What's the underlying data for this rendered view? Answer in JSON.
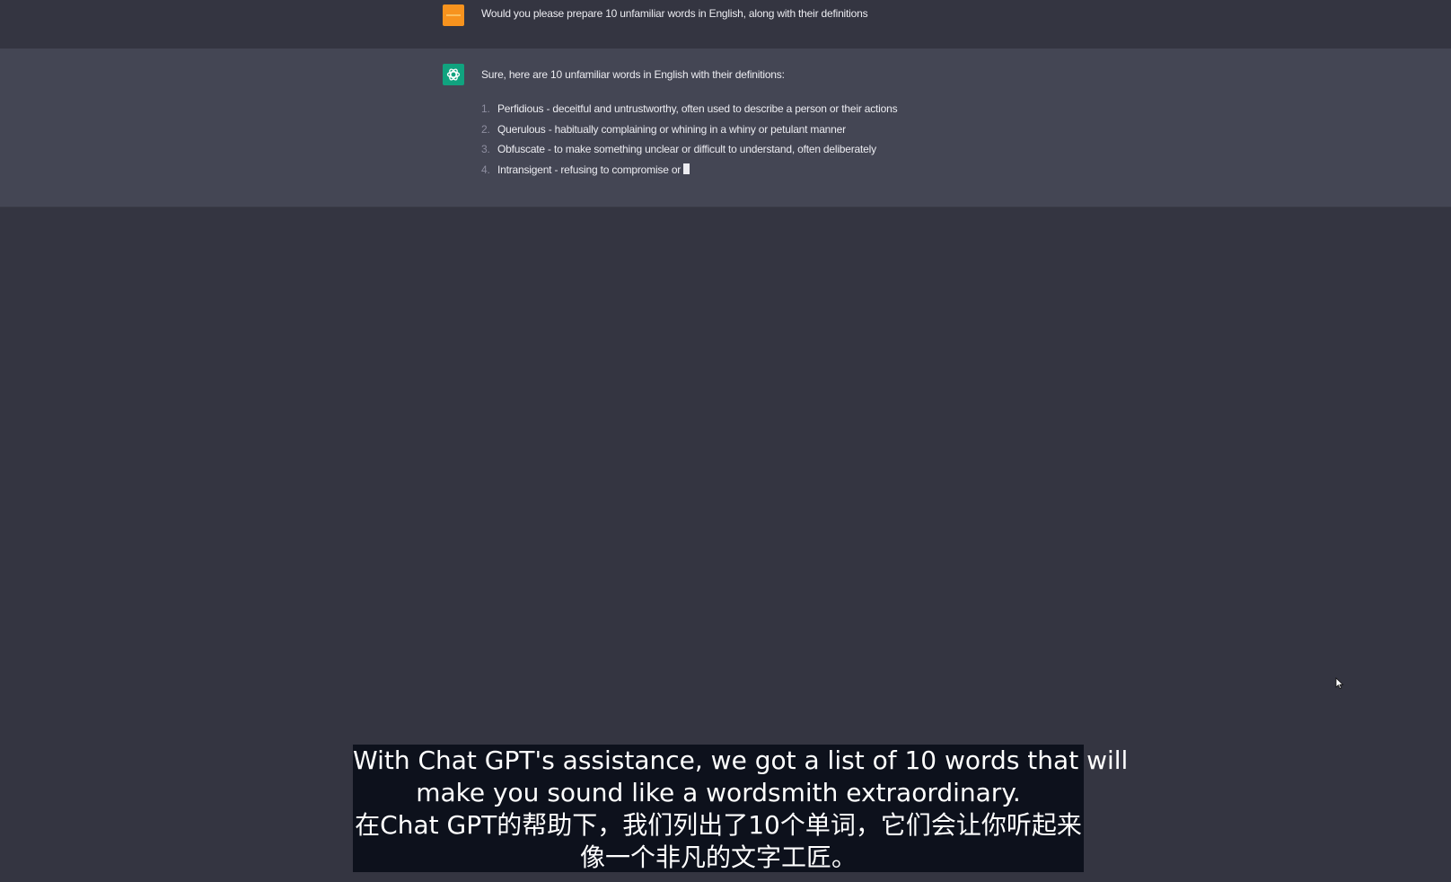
{
  "conversation": {
    "user_message": "Would you please prepare 10 unfamiliar words in English, along with their definitions",
    "assistant_intro": "Sure, here are 10 unfamiliar words in English with their definitions:",
    "definitions": [
      {
        "number": "1.",
        "text": "Perfidious - deceitful and untrustworthy, often used to describe a person or their actions"
      },
      {
        "number": "2.",
        "text": "Querulous - habitually complaining or whining in a whiny or petulant manner"
      },
      {
        "number": "3.",
        "text": "Obfuscate - to make something unclear or difficult to understand, often deliberately"
      },
      {
        "number": "4.",
        "text": "Intransigent - refusing to compromise or"
      }
    ]
  },
  "subtitle": {
    "english_line1": "With Chat GPT's assistance, we got a list of 10 words that will",
    "english_line2": "make you sound like a wordsmith extraordinary.",
    "chinese_line1": "在Chat GPT的帮助下，我们列出了10个单词，它们会让你听起来",
    "chinese_line2": "像一个非凡的文字工匠。"
  },
  "icons": {
    "user_avatar": "user-avatar-icon",
    "assistant_avatar": "openai-logo-icon",
    "pointer": "mouse-pointer-icon"
  },
  "colors": {
    "page_background": "#343541",
    "assistant_row_background": "#444654",
    "user_avatar": "#f7931e",
    "assistant_avatar": "#10a37f",
    "subtitle_background": "#0d111c"
  }
}
